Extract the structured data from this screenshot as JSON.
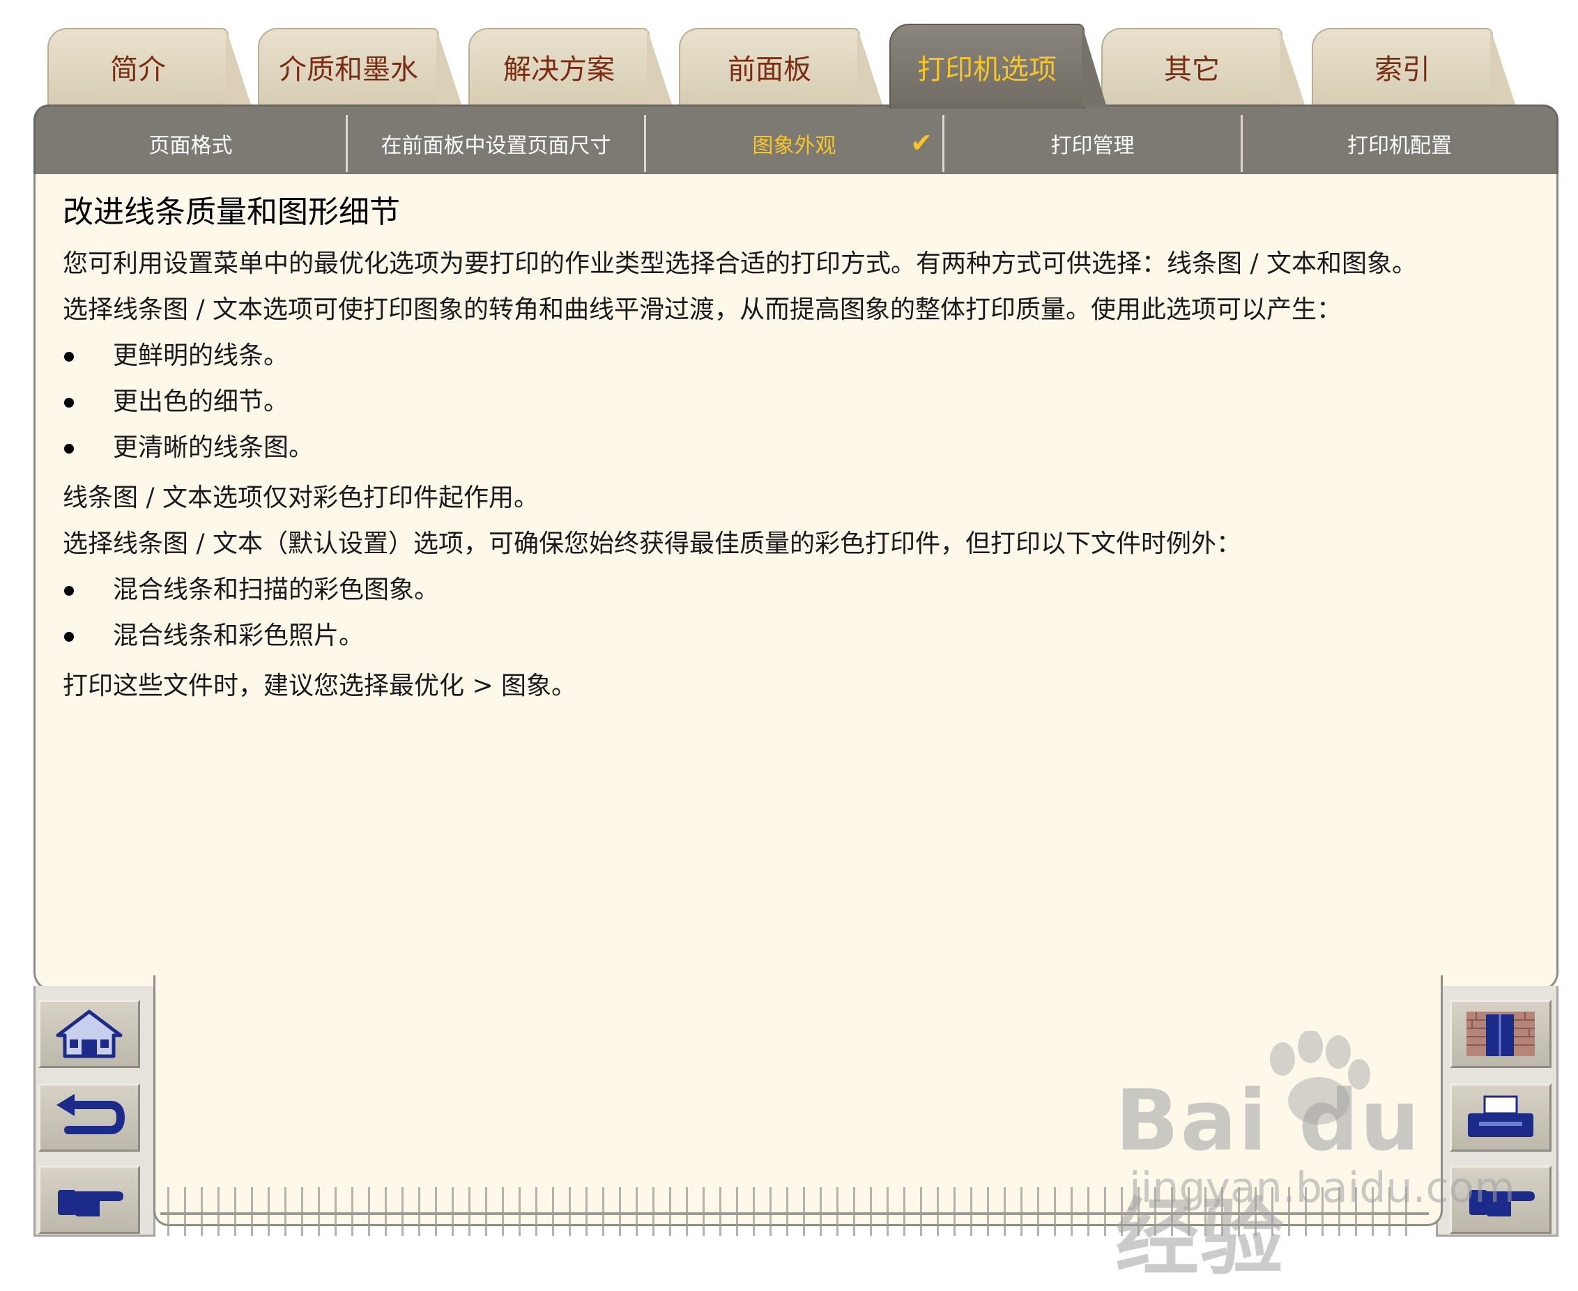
{
  "tabs": [
    {
      "label": "简介"
    },
    {
      "label": "介质和墨水"
    },
    {
      "label": "解决方案"
    },
    {
      "label": "前面板"
    },
    {
      "label": "打印机选项"
    },
    {
      "label": "其它"
    },
    {
      "label": "索引"
    }
  ],
  "subnav": [
    {
      "label": "页面格式"
    },
    {
      "label": "在前面板中设置页面尺寸"
    },
    {
      "label": "图象外观"
    },
    {
      "label": "打印管理"
    },
    {
      "label": "打印机配置"
    }
  ],
  "check_mark": "✔",
  "content": {
    "title": "改进线条质量和图形细节",
    "p1": "您可利用设置菜单中的最优化选项为要打印的作业类型选择合适的打印方式。有两种方式可供选择：线条图 / 文本和图象。",
    "p2": "选择线条图 / 文本选项可使打印图象的转角和曲线平滑过渡，从而提高图象的整体打印质量。使用此选项可以产生：",
    "list1": [
      "更鲜明的线条。",
      "更出色的细节。",
      "更清晰的线条图。"
    ],
    "p3": "线条图 / 文本选项仅对彩色打印件起作用。",
    "p4": "选择线条图 / 文本（默认设置）选项，可确保您始终获得最佳质量的彩色打印件，但打印以下文件时例外：",
    "list2": [
      "混合线条和扫描的彩色图象。",
      "混合线条和彩色照片。"
    ],
    "p5": "打印这些文件时，建议您选择最优化 > 图象。"
  },
  "watermark": {
    "text": "Bai du 经验",
    "url": "jingyan.baidu.com"
  },
  "colors": {
    "tab_text": "#7a2d12",
    "active_text": "#f6c52a",
    "panel_bg": "#fdf8ea",
    "bar_bg": "#7d7a74"
  },
  "icons": {
    "left": [
      "home-icon",
      "back-arrow-icon",
      "pointing-hand-right-icon"
    ],
    "right": [
      "brick-door-icon",
      "printer-icon",
      "pointing-hand-right-icon"
    ]
  }
}
